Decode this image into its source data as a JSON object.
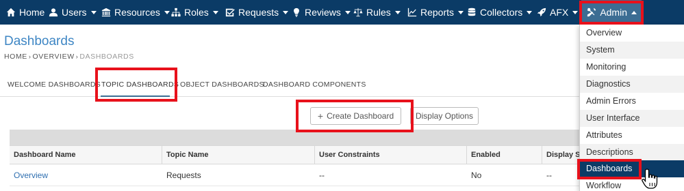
{
  "nav": {
    "items": [
      {
        "label": "Home",
        "icon": "home-icon",
        "caret": false
      },
      {
        "label": "Users",
        "icon": "users-icon",
        "caret": true
      },
      {
        "label": "Resources",
        "icon": "bank-icon",
        "caret": true
      },
      {
        "label": "Roles",
        "icon": "sitemap-icon",
        "caret": true
      },
      {
        "label": "Requests",
        "icon": "checkbox-icon",
        "caret": true
      },
      {
        "label": "Reviews",
        "icon": "lightbulb-icon",
        "caret": true
      },
      {
        "label": "Rules",
        "icon": "scales-icon",
        "caret": true
      },
      {
        "label": "Reports",
        "icon": "chart-icon",
        "caret": true
      },
      {
        "label": "Collectors",
        "icon": "database-icon",
        "caret": true
      },
      {
        "label": "AFX",
        "icon": "rocket-icon",
        "caret": true
      },
      {
        "label": "Admin",
        "icon": "tools-icon",
        "caret": true,
        "active": true
      }
    ],
    "bg_color": "#0b3b66",
    "active_color": "#3c6d93"
  },
  "page": {
    "title": "Dashboards",
    "breadcrumb": [
      "HOME",
      "OVERVIEW",
      "DASHBOARDS"
    ]
  },
  "tabs": [
    {
      "label": "WELCOME DASHBOARDS",
      "active": false
    },
    {
      "label": "TOPIC DASHBOARDS",
      "active": true
    },
    {
      "label": "OBJECT DASHBOARDS",
      "active": false
    },
    {
      "label": "DASHBOARD COMPONENTS",
      "active": false
    }
  ],
  "buttons": {
    "create_dashboard": "Create Dashboard",
    "display_options": "Display Options"
  },
  "table": {
    "columns": [
      "Dashboard Name",
      "Topic Name",
      "User Constraints",
      "Enabled",
      "Display S"
    ],
    "rows": [
      [
        "Overview",
        "Requests",
        "--",
        "No",
        "--"
      ]
    ]
  },
  "admin_menu": {
    "items": [
      "Overview",
      "System",
      "Monitoring",
      "Diagnostics",
      "Admin Errors",
      "User Interface",
      "Attributes",
      "Descriptions",
      "Dashboards",
      "Workflow"
    ],
    "selected": "Dashboards",
    "selected_color": "#0b3b66"
  },
  "highlight_color": "#e8111b"
}
